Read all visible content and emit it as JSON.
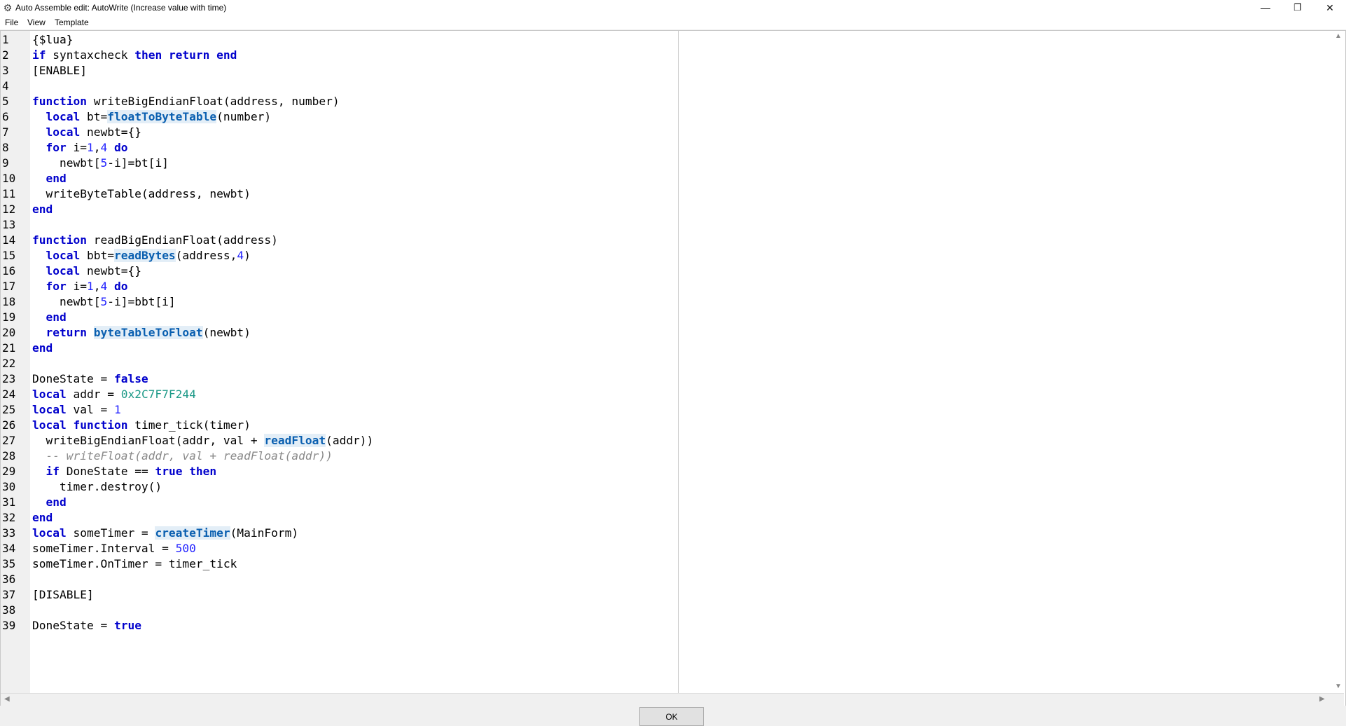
{
  "window": {
    "title": "Auto Assemble edit: AutoWrite (Increase value with time)",
    "app_icon": "cheat-engine-icon",
    "controls": {
      "minimize": "—",
      "maximize": "❐",
      "close": "✕"
    }
  },
  "menu": {
    "items": [
      "File",
      "View",
      "Template"
    ]
  },
  "editor": {
    "line_numbers": [
      "1",
      "2",
      "3",
      "4",
      "5",
      "6",
      "7",
      "8",
      "9",
      "10",
      "11",
      "12",
      "13",
      "14",
      "15",
      "16",
      "17",
      "18",
      "19",
      "20",
      "21",
      "22",
      "23",
      "24",
      "25",
      "26",
      "27",
      "28",
      "29",
      "30",
      "31",
      "32",
      "33",
      "34",
      "35",
      "36",
      "37",
      "38",
      "39"
    ],
    "lines": [
      [
        {
          "t": "{$lua}"
        }
      ],
      [
        {
          "t": "if",
          "c": "kw"
        },
        {
          "t": " syntaxcheck "
        },
        {
          "t": "then",
          "c": "kw"
        },
        {
          "t": " "
        },
        {
          "t": "return",
          "c": "kw"
        },
        {
          "t": " "
        },
        {
          "t": "end",
          "c": "kw"
        }
      ],
      [
        {
          "t": "[ENABLE]"
        }
      ],
      [],
      [
        {
          "t": "function",
          "c": "kw"
        },
        {
          "t": " writeBigEndianFloat(address, number)"
        }
      ],
      [
        {
          "t": "  "
        },
        {
          "t": "local",
          "c": "kw"
        },
        {
          "t": " bt="
        },
        {
          "t": "floatToByteTable",
          "c": "fn"
        },
        {
          "t": "(number)"
        }
      ],
      [
        {
          "t": "  "
        },
        {
          "t": "local",
          "c": "kw"
        },
        {
          "t": " newbt={}"
        }
      ],
      [
        {
          "t": "  "
        },
        {
          "t": "for",
          "c": "kw"
        },
        {
          "t": " i="
        },
        {
          "t": "1",
          "c": "num"
        },
        {
          "t": ","
        },
        {
          "t": "4",
          "c": "num"
        },
        {
          "t": " "
        },
        {
          "t": "do",
          "c": "kw"
        }
      ],
      [
        {
          "t": "    newbt["
        },
        {
          "t": "5",
          "c": "num"
        },
        {
          "t": "-i]=bt[i]"
        }
      ],
      [
        {
          "t": "  "
        },
        {
          "t": "end",
          "c": "kw"
        }
      ],
      [
        {
          "t": "  writeByteTable(address, newbt)"
        }
      ],
      [
        {
          "t": "end",
          "c": "kw"
        }
      ],
      [],
      [
        {
          "t": "function",
          "c": "kw"
        },
        {
          "t": " readBigEndianFloat(address)"
        }
      ],
      [
        {
          "t": "  "
        },
        {
          "t": "local",
          "c": "kw"
        },
        {
          "t": " bbt="
        },
        {
          "t": "readBytes",
          "c": "fn"
        },
        {
          "t": "(address,"
        },
        {
          "t": "4",
          "c": "num"
        },
        {
          "t": ")"
        }
      ],
      [
        {
          "t": "  "
        },
        {
          "t": "local",
          "c": "kw"
        },
        {
          "t": " newbt={}"
        }
      ],
      [
        {
          "t": "  "
        },
        {
          "t": "for",
          "c": "kw"
        },
        {
          "t": " i="
        },
        {
          "t": "1",
          "c": "num"
        },
        {
          "t": ","
        },
        {
          "t": "4",
          "c": "num"
        },
        {
          "t": " "
        },
        {
          "t": "do",
          "c": "kw"
        }
      ],
      [
        {
          "t": "    newbt["
        },
        {
          "t": "5",
          "c": "num"
        },
        {
          "t": "-i]=bbt[i]"
        }
      ],
      [
        {
          "t": "  "
        },
        {
          "t": "end",
          "c": "kw"
        }
      ],
      [
        {
          "t": "  "
        },
        {
          "t": "return",
          "c": "kw"
        },
        {
          "t": " "
        },
        {
          "t": "byteTableToFloat",
          "c": "fn"
        },
        {
          "t": "(newbt)"
        }
      ],
      [
        {
          "t": "end",
          "c": "kw"
        }
      ],
      [],
      [
        {
          "t": "DoneState = "
        },
        {
          "t": "false",
          "c": "kw"
        }
      ],
      [
        {
          "t": "local",
          "c": "kw"
        },
        {
          "t": " addr = "
        },
        {
          "t": "0x2C7F7F244",
          "c": "hex"
        }
      ],
      [
        {
          "t": "local",
          "c": "kw"
        },
        {
          "t": " val = "
        },
        {
          "t": "1",
          "c": "num"
        }
      ],
      [
        {
          "t": "local",
          "c": "kw"
        },
        {
          "t": " "
        },
        {
          "t": "function",
          "c": "kw"
        },
        {
          "t": " timer_tick(timer)"
        }
      ],
      [
        {
          "t": "  writeBigEndianFloat(addr, val + "
        },
        {
          "t": "readFloat",
          "c": "fn"
        },
        {
          "t": "(addr))"
        }
      ],
      [
        {
          "t": "  "
        },
        {
          "t": "-- writeFloat(addr, val + readFloat(addr))",
          "c": "cmt"
        }
      ],
      [
        {
          "t": "  "
        },
        {
          "t": "if",
          "c": "kw"
        },
        {
          "t": " DoneState == "
        },
        {
          "t": "true",
          "c": "kw"
        },
        {
          "t": " "
        },
        {
          "t": "then",
          "c": "kw"
        }
      ],
      [
        {
          "t": "    timer.destroy()"
        }
      ],
      [
        {
          "t": "  "
        },
        {
          "t": "end",
          "c": "kw"
        }
      ],
      [
        {
          "t": "end",
          "c": "kw"
        }
      ],
      [
        {
          "t": "local",
          "c": "kw"
        },
        {
          "t": " someTimer = "
        },
        {
          "t": "createTimer",
          "c": "fn"
        },
        {
          "t": "(MainForm)"
        }
      ],
      [
        {
          "t": "someTimer.Interval = "
        },
        {
          "t": "500",
          "c": "num"
        }
      ],
      [
        {
          "t": "someTimer.OnTimer = timer_tick"
        }
      ],
      [],
      [
        {
          "t": "[DISABLE]"
        }
      ],
      [],
      [
        {
          "t": "DoneState = "
        },
        {
          "t": "true",
          "c": "kw"
        }
      ]
    ]
  },
  "scrollbars": {
    "up": "▲",
    "down": "▼",
    "left": "◀",
    "right": "▶"
  },
  "buttons": {
    "ok": "OK"
  },
  "colors": {
    "keyword": "#0000cc",
    "function": "#0a5fb0",
    "function_bg": "#e3eef7",
    "number": "#2222ff",
    "hex": "#1e9a88",
    "comment": "#8a8a8a"
  }
}
